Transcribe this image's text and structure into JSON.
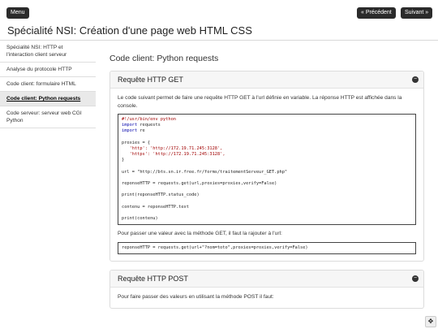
{
  "topbar": {
    "menu_label": "Menu",
    "prev_label": "« Précédent",
    "next_label": "Suivant »"
  },
  "page_title": "Spécialité NSI: Création d'une page web HTML CSS",
  "sidebar": {
    "items": [
      {
        "label": "Spécialité NSI: HTTP et l'interaction client serveur",
        "active": false
      },
      {
        "label": "Analyse du protocole HTTP",
        "active": false
      },
      {
        "label": "Code client: formulaire HTML",
        "active": false
      },
      {
        "label": "Code client: Python requests",
        "active": true
      },
      {
        "label": "Code serveur: serveur web CGI Python",
        "active": false
      }
    ]
  },
  "main": {
    "heading": "Code client: Python requests",
    "panel_get": {
      "title": "Requête HTTP GET",
      "intro": "Le code suivant permet de faire une requête HTTP GET à l'url définie en variable. La réponse HTTP est affichée dans la console.",
      "code": [
        "#!/usr/bin/env python",
        "import requests",
        "import re",
        "",
        "proxies = {",
        "   'http': 'http://172.19.71.245:3128',",
        "   'https': 'http://172.19.71.245:3128',",
        "}",
        "",
        "url = \"http://bts.sn.ir.free.fr/forms/traitementServeur_GET.php\"",
        "",
        "reponseHTTP = requests.get(url,proxies=proxies,verify=False)",
        "",
        "print(reponseHTTP.status_code)",
        "",
        "contenu = reponseHTTP.text",
        "",
        "print(contenu)"
      ],
      "note": "Pour passer une valeur avec la méthode GET, il faut la rajouter à l'url:",
      "code2": "reponseHTTP = requests.get(url+\"?nom=toto\",proxies=proxies,verify=False)"
    },
    "panel_post": {
      "title": "Requête HTTP POST",
      "intro": "Pour faire passer des valeurs en utilisant la méthode POST il faut:"
    }
  },
  "colors": {
    "button_bg": "#2b2b2b",
    "active_item_bg": "#e9e9e9",
    "keyword": "#0000aa",
    "string": "#a00000"
  },
  "icons": {
    "collapse": "minus-circle-icon",
    "corner": "puzzle-icon"
  }
}
